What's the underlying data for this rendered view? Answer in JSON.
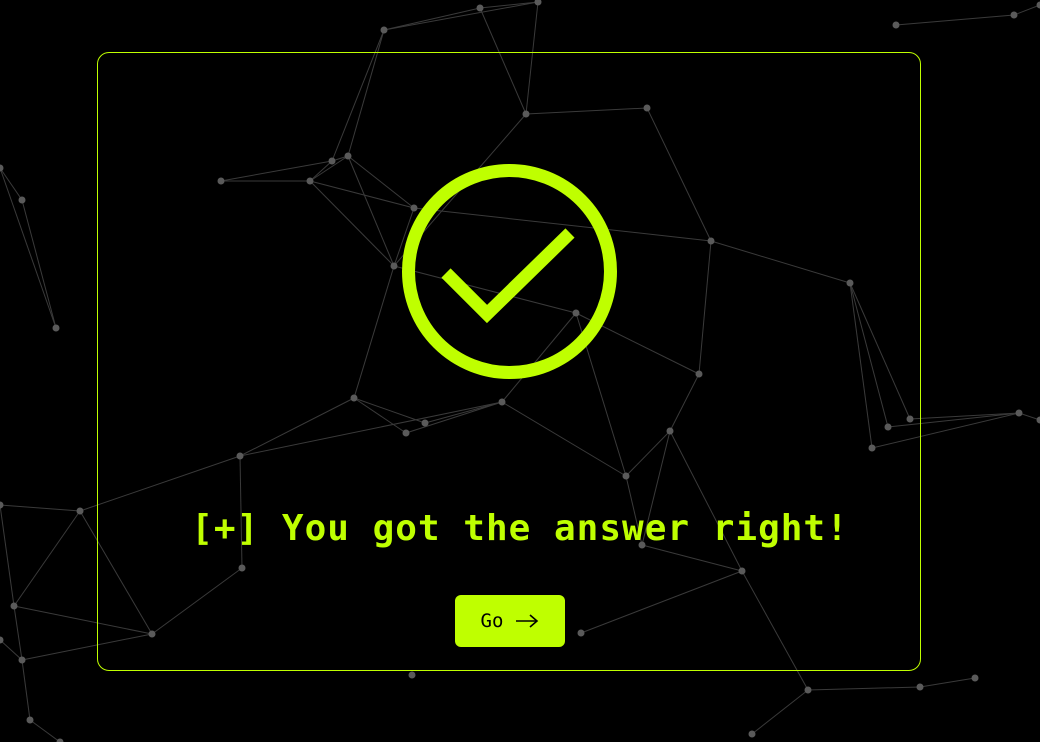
{
  "status": {
    "message": "[+] You got the answer right!",
    "icon": "check-circle-icon"
  },
  "actions": {
    "go_label": "Go",
    "go_icon": "arrow-right-icon"
  },
  "colors": {
    "accent": "#bfff00",
    "background": "#000000",
    "network_line": "#3a3a3a",
    "network_node": "#5a5a5a"
  }
}
